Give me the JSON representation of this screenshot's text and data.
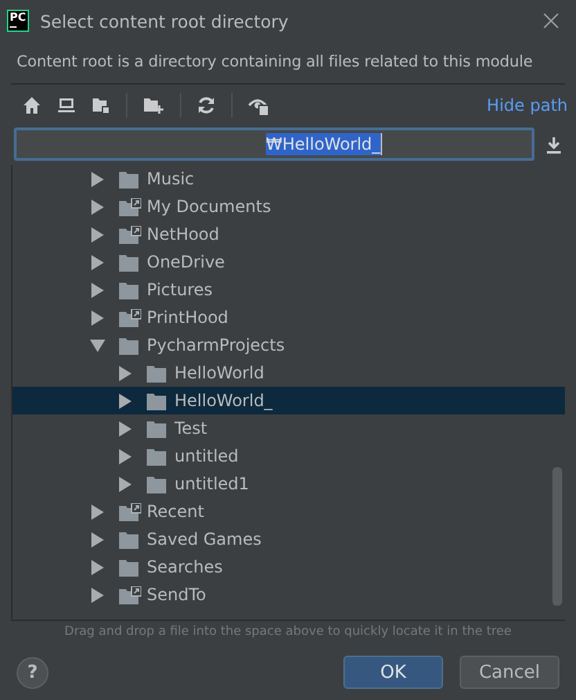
{
  "window": {
    "title": "Select content root directory",
    "logo": "PC"
  },
  "description": "Content root is a directory containing all files related to this module",
  "toolbar": {
    "hide_path": "Hide path"
  },
  "path_field": {
    "value": "₩HelloWorld_"
  },
  "tree": [
    {
      "label": "Music",
      "shortcut": false,
      "expanded": false,
      "selected": false
    },
    {
      "label": "My Documents",
      "shortcut": true,
      "expanded": false,
      "selected": false
    },
    {
      "label": "NetHood",
      "shortcut": true,
      "expanded": false,
      "selected": false
    },
    {
      "label": "OneDrive",
      "shortcut": false,
      "expanded": false,
      "selected": false
    },
    {
      "label": "Pictures",
      "shortcut": false,
      "expanded": false,
      "selected": false
    },
    {
      "label": "PrintHood",
      "shortcut": true,
      "expanded": false,
      "selected": false
    },
    {
      "label": "PycharmProjects",
      "shortcut": false,
      "expanded": true,
      "selected": false,
      "children": [
        {
          "label": "HelloWorld",
          "shortcut": false,
          "expanded": false,
          "selected": false
        },
        {
          "label": "HelloWorld_",
          "shortcut": false,
          "expanded": false,
          "selected": true
        },
        {
          "label": "Test",
          "shortcut": false,
          "expanded": false,
          "selected": false
        },
        {
          "label": "untitled",
          "shortcut": false,
          "expanded": false,
          "selected": false
        },
        {
          "label": "untitled1",
          "shortcut": false,
          "expanded": false,
          "selected": false
        }
      ]
    },
    {
      "label": "Recent",
      "shortcut": true,
      "expanded": false,
      "selected": false
    },
    {
      "label": "Saved Games",
      "shortcut": false,
      "expanded": false,
      "selected": false
    },
    {
      "label": "Searches",
      "shortcut": false,
      "expanded": false,
      "selected": false
    },
    {
      "label": "SendTo",
      "shortcut": true,
      "expanded": false,
      "selected": false
    }
  ],
  "hint": "Drag and drop a file into the space above to quickly locate it in the tree",
  "help_button": "?",
  "buttons": [
    "OK",
    "Cancel"
  ]
}
